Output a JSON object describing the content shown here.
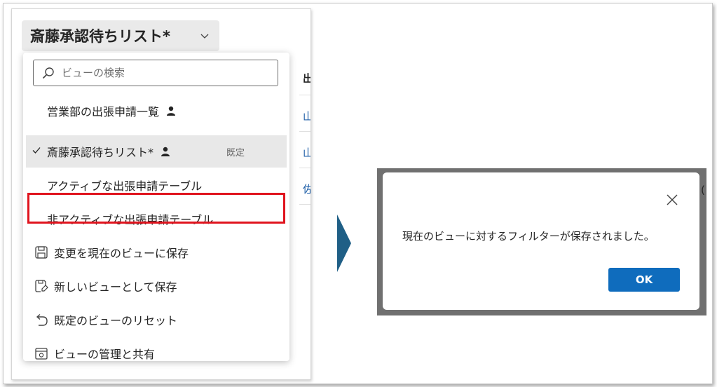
{
  "header": {
    "view_title": "斎藤承認待ちリスト*"
  },
  "background_table": {
    "header": "出",
    "cells": [
      "山",
      "山",
      "佐"
    ]
  },
  "search": {
    "placeholder": "ビューの検索"
  },
  "views": [
    {
      "label": "営業部の出張申請一覧",
      "personal": true
    },
    {
      "label": "斎藤承認待ちリスト*",
      "personal": true,
      "selected": true,
      "badge": "既定"
    },
    {
      "label": "アクティブな出張申請テーブル"
    },
    {
      "label": "非アクティブな出張申請テーブル"
    }
  ],
  "actions": [
    {
      "label": "変更を現在のビューに保存",
      "icon": "save-icon"
    },
    {
      "label": "新しいビューとして保存",
      "icon": "save-as-icon"
    },
    {
      "label": "既定のビューのリセット",
      "icon": "undo-icon"
    },
    {
      "label": "ビューの管理と共有",
      "icon": "manage-view-icon"
    }
  ],
  "dialog": {
    "message": "現在のビューに対するフィルターが保存されました。",
    "ok_label": "OK"
  },
  "edge_text": "(",
  "colors": {
    "accent": "#0f6cbd",
    "highlight": "#e0141e",
    "arrow": "#1f5f86"
  }
}
